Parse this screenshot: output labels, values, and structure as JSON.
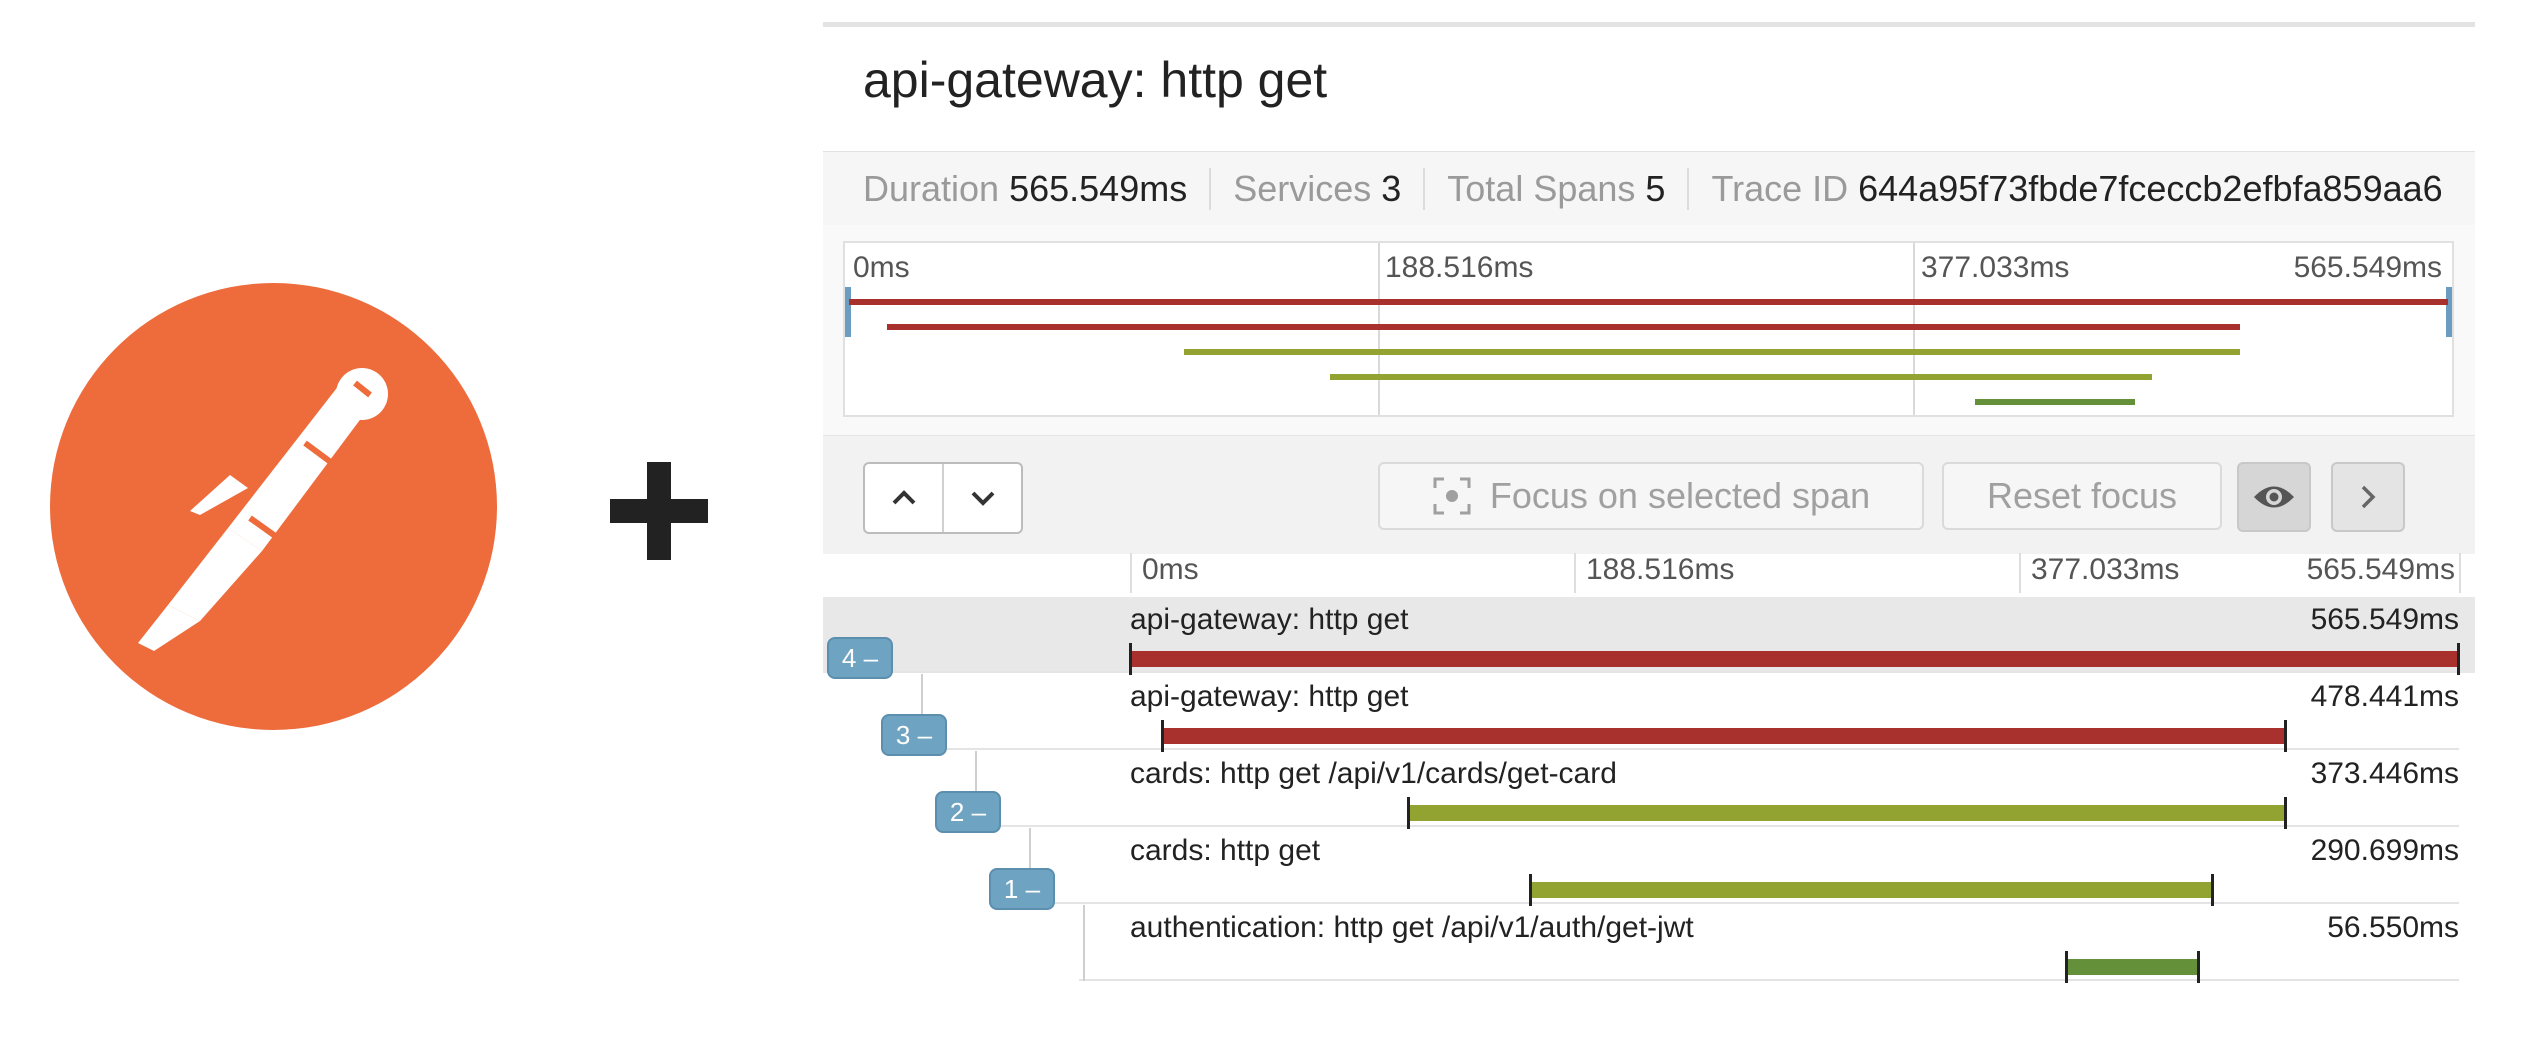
{
  "trace": {
    "title": "api-gateway: http get",
    "summary": [
      {
        "key": "Duration",
        "value": "565.549ms"
      },
      {
        "key": "Services",
        "value": "3"
      },
      {
        "key": "Total Spans",
        "value": "5"
      },
      {
        "key": "Trace ID",
        "value": "644a95f73fbde7fceccb2efbfa859aa6"
      }
    ]
  },
  "timeline": {
    "ticks": [
      "0ms",
      "188.516ms",
      "377.033ms",
      "565.549ms"
    ],
    "total_ms": 565.549
  },
  "toolbar": {
    "focus_label": "Focus on selected span",
    "reset_label": "Reset focus"
  },
  "spans": [
    {
      "name": "api-gateway: http get",
      "duration": "565.549ms",
      "start_ms": 0,
      "dur_ms": 565.549,
      "color": "#a8302d",
      "collapse": "4 –",
      "depth": 0,
      "selected": true
    },
    {
      "name": "api-gateway: http get",
      "duration": "478.441ms",
      "start_ms": 13.6,
      "dur_ms": 478.441,
      "color": "#a8302d",
      "collapse": "3 –",
      "depth": 1,
      "selected": false
    },
    {
      "name": "cards: http get /api/v1/cards/get-card",
      "duration": "373.446ms",
      "start_ms": 118.5,
      "dur_ms": 373.446,
      "color": "#93a332",
      "collapse": "2 –",
      "depth": 2,
      "selected": false
    },
    {
      "name": "cards: http get",
      "duration": "290.699ms",
      "start_ms": 170.3,
      "dur_ms": 290.699,
      "color": "#93a332",
      "collapse": "1 –",
      "depth": 3,
      "selected": false
    },
    {
      "name": "authentication: http get /api/v1/auth/get-jwt",
      "duration": "56.550ms",
      "start_ms": 398.2,
      "dur_ms": 56.55,
      "color": "#64903a",
      "collapse": "",
      "depth": 4,
      "selected": false
    }
  ]
}
